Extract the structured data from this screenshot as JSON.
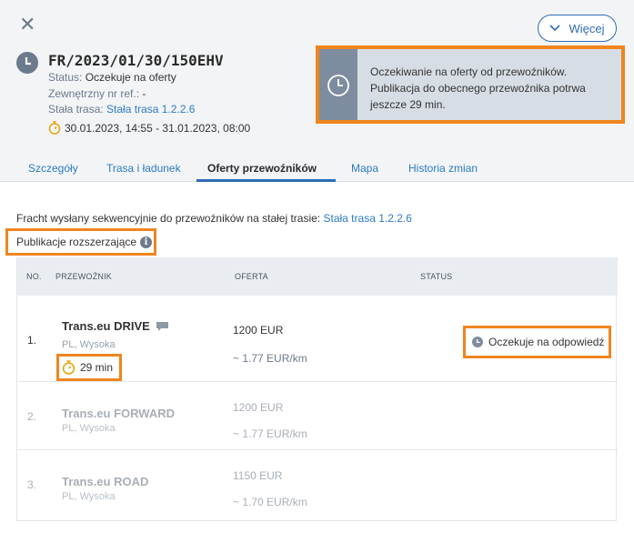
{
  "header": {
    "close_label": "✕",
    "more_label": "Więcej",
    "freight_id": "FR/2023/01/30/150EHV",
    "status_label": "Status:",
    "status_value": "Oczekuje na oferty",
    "extref_label": "Zewnętrzny nr ref.:",
    "extref_value": "-",
    "route_label": "Stała trasa:",
    "route_value": "Stała trasa 1.2.2.6",
    "date_range": "30.01.2023, 14:55 - 31.01.2023, 08:00"
  },
  "notice": {
    "line1": "Oczekiwanie na oferty od przewoźników.",
    "line2": "Publikacja do obecnego przewoźnika potrwa",
    "line3": "jeszcze 29 min."
  },
  "tabs": [
    "Szczegóły",
    "Trasa i ładunek",
    "Oferty przewoźników",
    "Mapa",
    "Historia zmian"
  ],
  "content": {
    "sequence_text": "Fracht wysłany sekwencyjnie do przewoźników na stałej trasie:",
    "sequence_link": "Stała trasa 1.2.2.6",
    "extended_pub": "Publikacje rozszerzające"
  },
  "table": {
    "headers": [
      "NO.",
      "PRZEWOŹNIK",
      "OFERTA",
      "STATUS"
    ],
    "rows": [
      {
        "no": "1.",
        "carrier": "Trans.eu DRIVE",
        "location": "PL, Wysoka",
        "timer": "29 min",
        "price": "1200  EUR",
        "per_km": "~ 1.77 EUR/km",
        "status": "Oczekuje na odpowiedź"
      },
      {
        "no": "2.",
        "carrier": "Trans.eu FORWARD",
        "location": "PL, Wysoka",
        "price": "1200  EUR",
        "per_km": "~ 1.77 EUR/km"
      },
      {
        "no": "3.",
        "carrier": "Trans.eu ROAD",
        "location": "PL, Wysoka",
        "price": "1150  EUR",
        "per_km": "~ 1.70 EUR/km"
      }
    ]
  },
  "colors": {
    "accent": "#2c6db5",
    "highlight": "#f0851e",
    "timer": "#e8a81a"
  }
}
